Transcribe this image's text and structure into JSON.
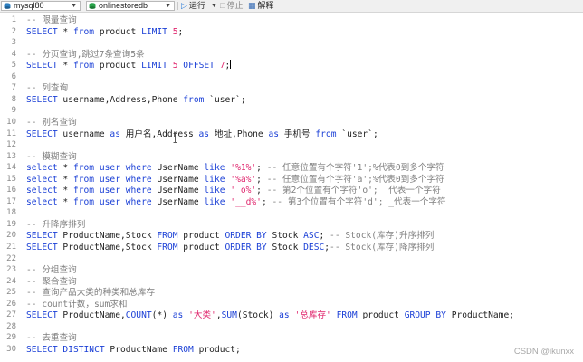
{
  "toolbar": {
    "connection": "mysql80",
    "database": "onlinestoredb",
    "run_label": "运行",
    "stop_label": "停止",
    "explain_label": "解释"
  },
  "lines": [
    {
      "n": "1",
      "t": [
        [
          "cm",
          "-- 限量查询"
        ]
      ]
    },
    {
      "n": "2",
      "t": [
        [
          "kw",
          "SELECT"
        ],
        [
          "pl",
          " * "
        ],
        [
          "kw",
          "from"
        ],
        [
          "pl",
          " product "
        ],
        [
          "kw",
          "LIMIT"
        ],
        [
          "nu",
          " 5"
        ],
        [
          "pl",
          ";"
        ]
      ]
    },
    {
      "n": "3",
      "t": []
    },
    {
      "n": "4",
      "t": [
        [
          "cm",
          "-- 分页查询,跳过7条查询5条"
        ]
      ]
    },
    {
      "n": "5",
      "t": [
        [
          "kw",
          "SELECT"
        ],
        [
          "pl",
          " * "
        ],
        [
          "kw",
          "from"
        ],
        [
          "pl",
          " product "
        ],
        [
          "kw",
          "LIMIT"
        ],
        [
          "nu",
          " 5"
        ],
        [
          "kw",
          " OFFSET"
        ],
        [
          "nu",
          " 7"
        ],
        [
          "pl",
          ";"
        ]
      ],
      "caret": true
    },
    {
      "n": "6",
      "t": []
    },
    {
      "n": "7",
      "t": [
        [
          "cm",
          "-- 列查询"
        ]
      ]
    },
    {
      "n": "8",
      "t": [
        [
          "kw",
          "SELECT"
        ],
        [
          "pl",
          " username,Address,Phone "
        ],
        [
          "kw",
          "from"
        ],
        [
          "pl",
          " `user`;"
        ]
      ]
    },
    {
      "n": "9",
      "t": []
    },
    {
      "n": "10",
      "t": [
        [
          "cm",
          "-- 别名查询"
        ]
      ]
    },
    {
      "n": "11",
      "t": [
        [
          "kw",
          "SELECT"
        ],
        [
          "pl",
          " username "
        ],
        [
          "kw",
          "as"
        ],
        [
          "pl",
          " 用户名,Address "
        ],
        [
          "kw",
          "as"
        ],
        [
          "pl",
          " 地址,Phone "
        ],
        [
          "kw",
          "as"
        ],
        [
          "pl",
          " 手机号 "
        ],
        [
          "kw",
          "from"
        ],
        [
          "pl",
          " `user`;"
        ]
      ]
    },
    {
      "n": "12",
      "t": []
    },
    {
      "n": "13",
      "t": [
        [
          "cm",
          "-- 模糊查询"
        ]
      ]
    },
    {
      "n": "14",
      "t": [
        [
          "kw",
          "select"
        ],
        [
          "pl",
          " * "
        ],
        [
          "kw",
          "from"
        ],
        [
          "kw",
          " user"
        ],
        [
          "kw",
          " where"
        ],
        [
          "pl",
          " UserName "
        ],
        [
          "kw",
          "like"
        ],
        [
          "st",
          " '%1%'"
        ],
        [
          "pl",
          "; "
        ],
        [
          "cm",
          "-- 任意位置有个字符'1';%代表0到多个字符"
        ]
      ]
    },
    {
      "n": "15",
      "t": [
        [
          "kw",
          "select"
        ],
        [
          "pl",
          " * "
        ],
        [
          "kw",
          "from"
        ],
        [
          "kw",
          " user"
        ],
        [
          "kw",
          " where"
        ],
        [
          "pl",
          " UserName "
        ],
        [
          "kw",
          "like"
        ],
        [
          "st",
          " '%a%'"
        ],
        [
          "pl",
          "; "
        ],
        [
          "cm",
          "-- 任意位置有个字符'a';%代表0到多个字符"
        ]
      ]
    },
    {
      "n": "16",
      "t": [
        [
          "kw",
          "select"
        ],
        [
          "pl",
          " * "
        ],
        [
          "kw",
          "from"
        ],
        [
          "kw",
          " user"
        ],
        [
          "kw",
          " where"
        ],
        [
          "pl",
          " UserName "
        ],
        [
          "kw",
          "like"
        ],
        [
          "st",
          " '_o%'"
        ],
        [
          "pl",
          "; "
        ],
        [
          "cm",
          "-- 第2个位置有个字符'o'; _代表一个字符"
        ]
      ]
    },
    {
      "n": "17",
      "t": [
        [
          "kw",
          "select"
        ],
        [
          "pl",
          " * "
        ],
        [
          "kw",
          "from"
        ],
        [
          "kw",
          " user"
        ],
        [
          "kw",
          " where"
        ],
        [
          "pl",
          " UserName "
        ],
        [
          "kw",
          "like"
        ],
        [
          "st",
          " '__d%'"
        ],
        [
          "pl",
          "; "
        ],
        [
          "cm",
          "-- 第3个位置有个字符'd'; _代表一个字符"
        ]
      ]
    },
    {
      "n": "18",
      "t": []
    },
    {
      "n": "19",
      "t": [
        [
          "cm",
          "-- 升降序排列"
        ]
      ]
    },
    {
      "n": "20",
      "t": [
        [
          "kw",
          "SELECT"
        ],
        [
          "pl",
          " ProductName,Stock "
        ],
        [
          "kw",
          "FROM"
        ],
        [
          "pl",
          " product "
        ],
        [
          "kw",
          "ORDER BY"
        ],
        [
          "pl",
          " Stock "
        ],
        [
          "kw",
          "ASC"
        ],
        [
          "pl",
          "; "
        ],
        [
          "cm",
          "-- Stock(库存)升序排列"
        ]
      ]
    },
    {
      "n": "21",
      "t": [
        [
          "kw",
          "SELECT"
        ],
        [
          "pl",
          " ProductName,Stock "
        ],
        [
          "kw",
          "FROM"
        ],
        [
          "pl",
          " product "
        ],
        [
          "kw",
          "ORDER BY"
        ],
        [
          "pl",
          " Stock "
        ],
        [
          "kw",
          "DESC"
        ],
        [
          "pl",
          ";"
        ],
        [
          "cm",
          "-- Stock(库存)降序排列"
        ]
      ]
    },
    {
      "n": "22",
      "t": []
    },
    {
      "n": "23",
      "t": [
        [
          "cm",
          "-- 分组查询"
        ]
      ]
    },
    {
      "n": "24",
      "t": [
        [
          "cm",
          "-- 聚合查询"
        ]
      ]
    },
    {
      "n": "25",
      "t": [
        [
          "cm",
          "-- 查询产品大类的种类和总库存"
        ]
      ]
    },
    {
      "n": "26",
      "t": [
        [
          "cm",
          "-- count计数，sum求和"
        ]
      ]
    },
    {
      "n": "27",
      "t": [
        [
          "kw",
          "SELECT"
        ],
        [
          "pl",
          " ProductName,"
        ],
        [
          "kw",
          "COUNT"
        ],
        [
          "pl",
          "(*) "
        ],
        [
          "kw",
          "as"
        ],
        [
          "st",
          " '大类'"
        ],
        [
          "pl",
          ","
        ],
        [
          "kw",
          "SUM"
        ],
        [
          "pl",
          "(Stock) "
        ],
        [
          "kw",
          "as"
        ],
        [
          "st",
          " '总库存'"
        ],
        [
          "kw",
          " FROM"
        ],
        [
          "pl",
          " product "
        ],
        [
          "kw",
          "GROUP BY"
        ],
        [
          "pl",
          " ProductName;"
        ]
      ]
    },
    {
      "n": "28",
      "t": []
    },
    {
      "n": "29",
      "t": [
        [
          "cm",
          "-- 去重查询"
        ]
      ]
    },
    {
      "n": "30",
      "t": [
        [
          "kw",
          "SELECT"
        ],
        [
          "kw",
          " DISTINCT"
        ],
        [
          "pl",
          " ProductName "
        ],
        [
          "kw",
          "FROM"
        ],
        [
          "pl",
          " product;"
        ]
      ]
    }
  ],
  "watermark": "CSDN @ikunxx",
  "colors": {
    "keyword": "#1a3fd6",
    "comment": "#7f7f7f",
    "string": "#e0266d",
    "plain": "#1f1f1f"
  }
}
